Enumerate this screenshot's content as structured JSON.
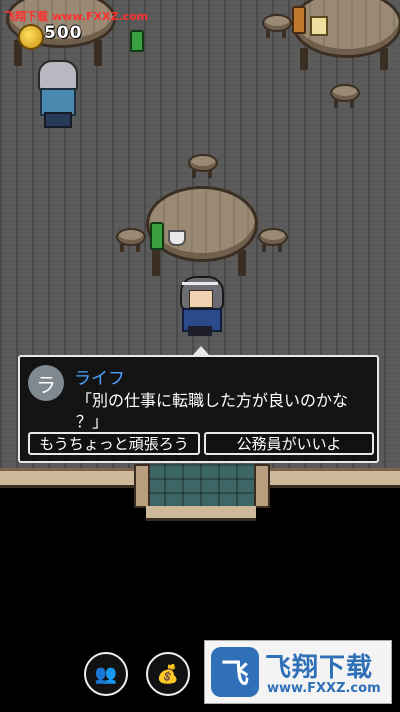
{
  "watermark_top": {
    "site": "飞翔下载",
    "url": "www.FXXZ.com"
  },
  "hud": {
    "gold": "500",
    "gold_icon": "coin-icon"
  },
  "dialog": {
    "avatar_initial": "ラ",
    "speaker": "ライフ",
    "line1": "「別の仕事に転職した方が良いのかな",
    "line2": "？」",
    "choices": [
      {
        "label": "もうちょっと頑張ろう"
      },
      {
        "label": "公務員がいいよ"
      }
    ]
  },
  "buttons": {
    "people_icon": "people-icon",
    "bag_icon": "money-bag-icon",
    "people_glyph": "👥",
    "bag_glyph": "💰"
  },
  "watermark_bottom": {
    "logo": "飞",
    "title": "飞翔下载",
    "url": "www.FXXZ.com"
  },
  "colors": {
    "speaker": "#4ea3ff",
    "dialog_border": "#e8e8e8",
    "floor": "#5b5b5b"
  }
}
